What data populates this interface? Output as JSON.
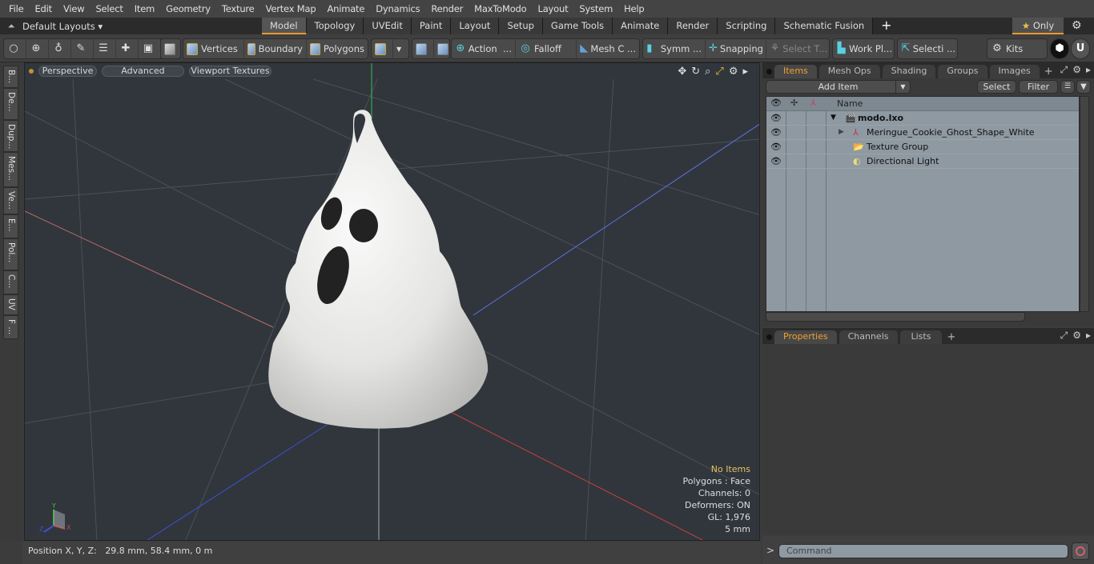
{
  "menu": [
    "File",
    "Edit",
    "View",
    "Select",
    "Item",
    "Geometry",
    "Texture",
    "Vertex Map",
    "Animate",
    "Dynamics",
    "Render",
    "MaxToModo",
    "Layout",
    "System",
    "Help"
  ],
  "layout_bar": {
    "layout_name": "Default Layouts ▾",
    "tabs": [
      "Model",
      "Topology",
      "UVEdit",
      "Paint",
      "Layout",
      "Setup",
      "Game Tools",
      "Animate",
      "Render",
      "Scripting",
      "Schematic Fusion"
    ],
    "active_tab": "Model",
    "add_tab": "+",
    "only_label": "Only",
    "only_icon": "★"
  },
  "toolbar": {
    "vertices": "Vertices",
    "boundary": "Boundary",
    "polygons": "Polygons",
    "action": "Action",
    "action_more": "...",
    "falloff": "Falloff",
    "mesh_c": "Mesh C ...",
    "symm": "Symm ...",
    "snapping": "Snapping",
    "select_t": "Select T...",
    "work_pl": "Work Pl...",
    "selecti": "Selecti ...",
    "kits": "Kits"
  },
  "left_tabs": [
    "B...",
    "De...",
    "Dup...",
    "Mes...",
    "Ve...",
    "E...",
    "Pol...",
    "C...",
    "UV",
    "F ..."
  ],
  "viewport": {
    "perspective": "Perspective",
    "advanced": "Advanced",
    "viewport_textures": "Viewport Textures",
    "hud": {
      "selection": "No Items",
      "polygons": "Polygons : Face",
      "channels": "Channels: 0",
      "deformers": "Deformers: ON",
      "gl": "GL: 1,976",
      "scale": "5 mm"
    },
    "axis_labels": {
      "x": "X",
      "y": "Y",
      "z": "Z"
    }
  },
  "status": {
    "position_label": "Position X, Y, Z:",
    "position_value": "29.8 mm, 58.4 mm, 0 m"
  },
  "items_panel": {
    "tabs": [
      "Items",
      "Mesh Ops",
      "Shading",
      "Groups",
      "Images"
    ],
    "active_tab": "Items",
    "add_item": "Add Item",
    "select": "Select",
    "filter": "Filter",
    "name_header": "Name",
    "tree": [
      {
        "label": "modo.lxo",
        "bold": true,
        "level": 0,
        "expander": "▼",
        "icon": "clapper-icon"
      },
      {
        "label": "Meringue_Cookie_Ghost_Shape_White",
        "level": 1,
        "expander": "▶",
        "icon": "mesh-locator-icon"
      },
      {
        "label": "Texture Group",
        "level": 1,
        "expander": "",
        "icon": "folder-icon"
      },
      {
        "label": "Directional Light",
        "level": 1,
        "expander": "",
        "icon": "light-icon"
      }
    ]
  },
  "properties_panel": {
    "tabs": [
      "Properties",
      "Channels",
      "Lists"
    ],
    "active_tab": "Properties"
  },
  "command": {
    "prompt": ">",
    "placeholder": "Command"
  },
  "colors": {
    "accent": "#e89a2c",
    "active_tab_text": "#f0a030",
    "hud_highlight": "#e8c060",
    "axis_x": "#c84040",
    "axis_y": "#40c040",
    "axis_z": "#4050d0"
  }
}
